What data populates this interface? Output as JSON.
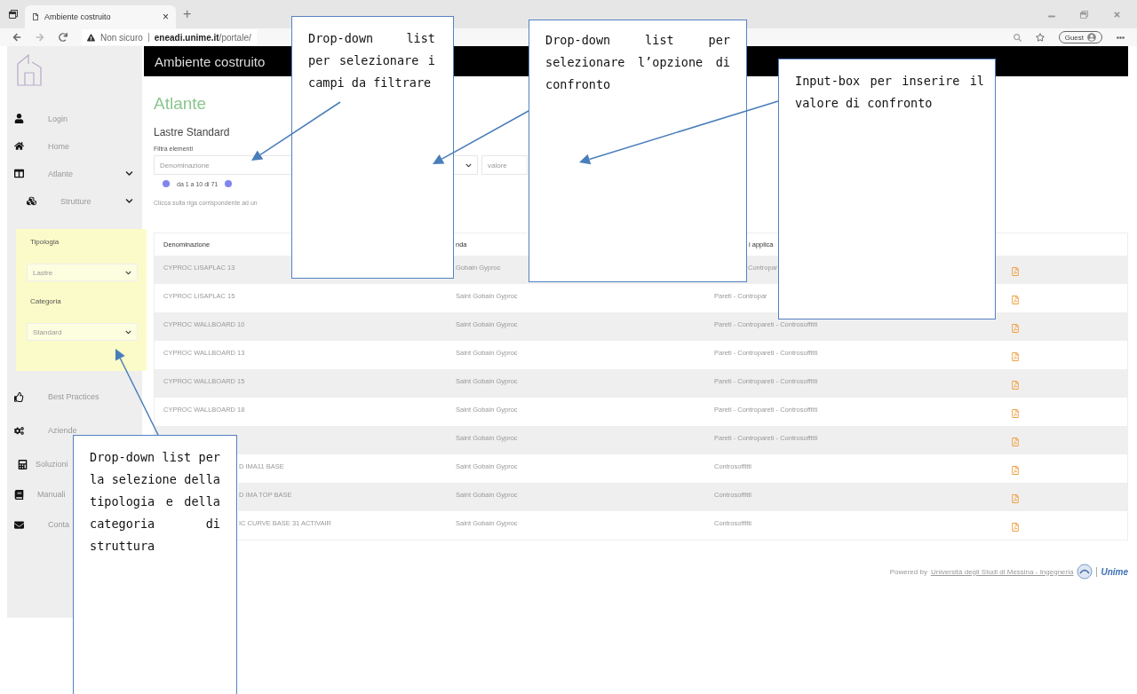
{
  "browser": {
    "tab_title": "Ambiente costruito",
    "close": "×",
    "new_tab": "+",
    "security": "Non sicuro",
    "url_host": "eneadi.unime.it",
    "url_path": "/portale/",
    "profile": "Guest"
  },
  "sidebar": {
    "items": [
      {
        "label": "Login",
        "expandable": false
      },
      {
        "label": "Home",
        "expandable": false
      },
      {
        "label": "Atlante",
        "expandable": true
      },
      {
        "label": "Strutture",
        "expandable": true
      }
    ],
    "filter_panel": [
      {
        "label": "Tipologia",
        "value": "Lastre"
      },
      {
        "label": "Categoria",
        "value": "Standard"
      }
    ],
    "items_after": [
      {
        "label": "Best Practices"
      },
      {
        "label": "Aziende"
      },
      {
        "label": "Soluzioni"
      },
      {
        "label": "Manuali"
      },
      {
        "label": "Conta"
      }
    ]
  },
  "main": {
    "header_title": "Ambiente costruito",
    "page_title": "Atlante",
    "subtitle": "Lastre Standard",
    "filter_label": "Filtra elementi",
    "field_select": "Denominazione",
    "value_placeholder": "valore",
    "pagination": "da 1 a 10 di 71",
    "hint": "Clicca sulla riga corrispondente ad un"
  },
  "table": {
    "columns": [
      "Denominazione",
      "nda",
      "i applica",
      ""
    ],
    "rows": [
      {
        "name": "CYPROC LISAPLAC 13",
        "company": "Gobain Gyproc",
        "uses": "Contropar"
      },
      {
        "name": "CYPROC LISAPLAC 15",
        "company": "Saint Gobain Gyproc",
        "uses": "Pareti - Contropar"
      },
      {
        "name": "CYPROC WALLBOARD 10",
        "company": "Saint Gobain Gyproc",
        "uses": "Pareti - Contropareti - Controsoffitti"
      },
      {
        "name": "CYPROC WALLBOARD 13",
        "company": "Saint Gobain Gyproc",
        "uses": "Pareti - Contropareti - Controsoffitti"
      },
      {
        "name": "CYPROC WALLBOARD 15",
        "company": "Saint Gobain Gyproc",
        "uses": "Pareti - Contropareti - Controsoffitti"
      },
      {
        "name": "CYPROC WALLBOARD 18",
        "company": "Saint Gobain Gyproc",
        "uses": "Pareti - Contropareti - Controsoffitti"
      },
      {
        "company": "Saint Gobain Gyproc",
        "uses": "Pareti - Contropareti - Controsoffitti"
      },
      {
        "name": "D IMA11 BASE",
        "company": "Saint Gobain Gyproc",
        "uses": "Controsoffitti"
      },
      {
        "name": "D IMA TOP BASE",
        "company": "Saint Gobain Gyproc",
        "uses": "Controsoffitti"
      },
      {
        "name": "IC CURVE BASE 31 ACTIVAIR",
        "company": "Saint Gobain Gyproc",
        "uses": "Controsoffitti"
      }
    ]
  },
  "footer": {
    "prefix": "Powered by",
    "link": "Università degli Studi di Messina - Ingegneria",
    "logo_text": "Unime"
  },
  "callouts": [
    {
      "text": "Drop-down list per selezionare i campi da filtrare"
    },
    {
      "text": "Drop-down list per selezionare l’opzione di confronto"
    },
    {
      "text": "Input-box per inserire il valore di confronto"
    },
    {
      "text": "Drop-down list per la selezione della tipologia e della categoria di struttura"
    }
  ]
}
